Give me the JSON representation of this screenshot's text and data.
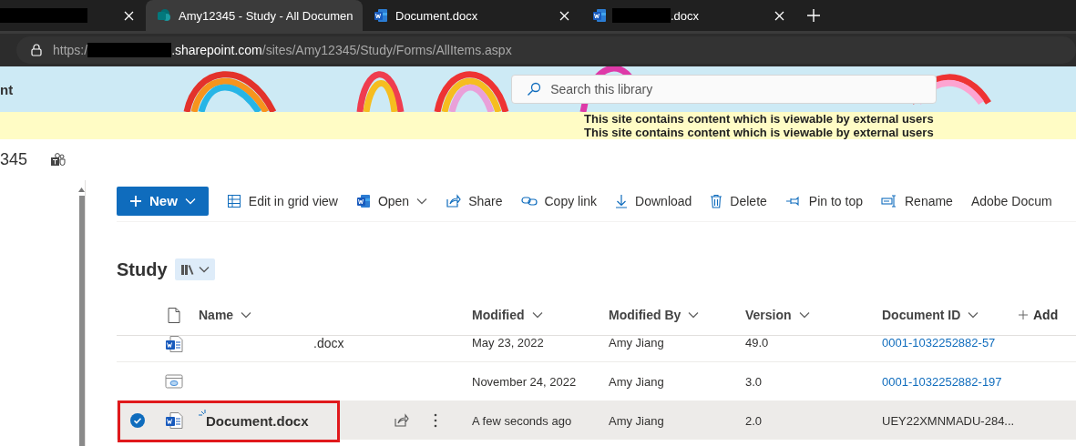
{
  "browser": {
    "tabs": [
      {
        "redacted": true,
        "selected": false
      },
      {
        "title": "Amy12345 - Study - All Documen",
        "selected": true
      },
      {
        "title": "Document.docx",
        "selected": false
      },
      {
        "redacted": true,
        "title": ".docx",
        "selected": false
      }
    ],
    "address": {
      "scheme": "https:/",
      "redacted": true,
      "host": ".sharepoint.com",
      "path": "/sites/Amy12345/Study/Forms/AllItems.aspx"
    }
  },
  "header": {
    "site_name": "nt",
    "search": {
      "placeholder": "Search this library"
    }
  },
  "notice": {
    "lines": [
      "This site contains content which is viewable by external users",
      "This site contains content which is viewable by external users"
    ]
  },
  "site": {
    "title": "345"
  },
  "command_bar": [
    {
      "kind": "primary",
      "label": "New",
      "dropdown": true
    },
    {
      "kind": "command",
      "label": "Edit in grid view",
      "dropdown": false
    },
    {
      "kind": "command",
      "label": "Open",
      "dropdown": true
    },
    {
      "kind": "command",
      "label": "Share",
      "dropdown": false
    },
    {
      "kind": "command",
      "label": "Copy link",
      "dropdown": false
    },
    {
      "kind": "command",
      "label": "Download",
      "dropdown": false
    },
    {
      "kind": "command",
      "label": "Delete",
      "dropdown": false
    },
    {
      "kind": "command",
      "label": "Pin to top",
      "dropdown": false
    },
    {
      "kind": "command",
      "label": "Rename",
      "dropdown": false
    },
    {
      "kind": "command",
      "label": "Adobe Docum",
      "dropdown": false
    }
  ],
  "library": {
    "title": "Study",
    "columns": [
      "Name",
      "Modified",
      "Modified By",
      "Version",
      "Document ID"
    ],
    "add_column": "Add",
    "rows": [
      {
        "selected": false,
        "highlighted": false,
        "is_new": false,
        "name_redacted": true,
        "name": ".docx",
        "modified": "May 23, 2022",
        "modified_by": "Amy Jiang",
        "version": "49.0",
        "document_id": "0001-1032252882-57",
        "id_link": true
      },
      {
        "selected": false,
        "highlighted": false,
        "is_new": false,
        "name_redacted": false,
        "modified": "November 24, 2022",
        "modified_by": "Amy Jiang",
        "version": "3.0",
        "document_id": "0001-1032252882-197",
        "id_link": true
      },
      {
        "selected": true,
        "highlighted": true,
        "is_new": true,
        "name_redacted": false,
        "name": "Document.docx",
        "modified": "A few seconds ago",
        "modified_by": "Amy Jiang",
        "version": "2.0",
        "document_id": "UEY22XMNMADU-284...",
        "id_link": false
      }
    ]
  }
}
